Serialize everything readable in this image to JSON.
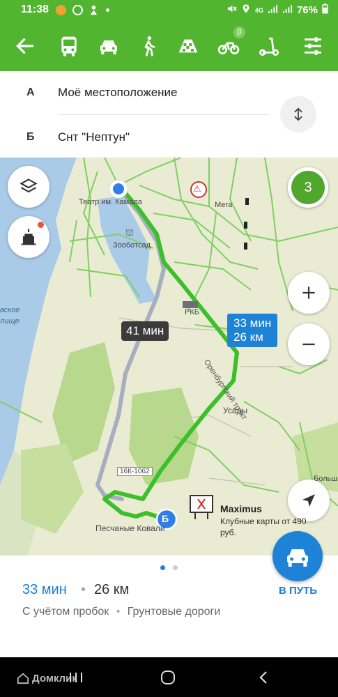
{
  "status_bar": {
    "time": "11:38",
    "battery": "76%",
    "network": "4G"
  },
  "transport": {
    "back": "back-arrow",
    "modes": [
      "bus",
      "car",
      "walk",
      "taxi",
      "bike",
      "scooter"
    ],
    "active": "car",
    "bike_badge": "β",
    "settings": "sliders-icon"
  },
  "route": {
    "from_letter": "А",
    "from_text": "Моё местоположение",
    "to_letter": "Б",
    "to_text": "Снт \"Нептун\""
  },
  "map": {
    "labels": {
      "theater": "Театр им. Камала",
      "zoo": "Зооботсад",
      "mega": "Мега",
      "rkb": "РКБ",
      "tract": "Оренбургский тракт",
      "usady": "Усады",
      "road": "16К-1062",
      "peschanye": "Песчаные Ковали",
      "bolshie": "Больши",
      "left_label_1": "вское",
      "left_label_2": "лище"
    },
    "alt_time": "41 мин",
    "main_time": "33 мин",
    "main_dist": "26 км",
    "badge_count": "3",
    "dest_marker": "Б",
    "ad_title": "Maximus",
    "ad_sub": "Клубные карты от 490 руб."
  },
  "summary": {
    "time": "33 мин",
    "sep": "•",
    "dist": "26 км",
    "traffic": "С учётом пробок",
    "dot": "•",
    "roads": "Грунтовые дороги",
    "go_label": "В ПУТЬ"
  },
  "nav_bar": {
    "watermark": "Домклик"
  },
  "colors": {
    "brand_green": "#52b52f",
    "route_green": "#3cbf2a",
    "alt_route": "#a7aec0",
    "accent_blue": "#1e82d6",
    "water": "#aacbe8",
    "forest": "#b8d98d"
  }
}
